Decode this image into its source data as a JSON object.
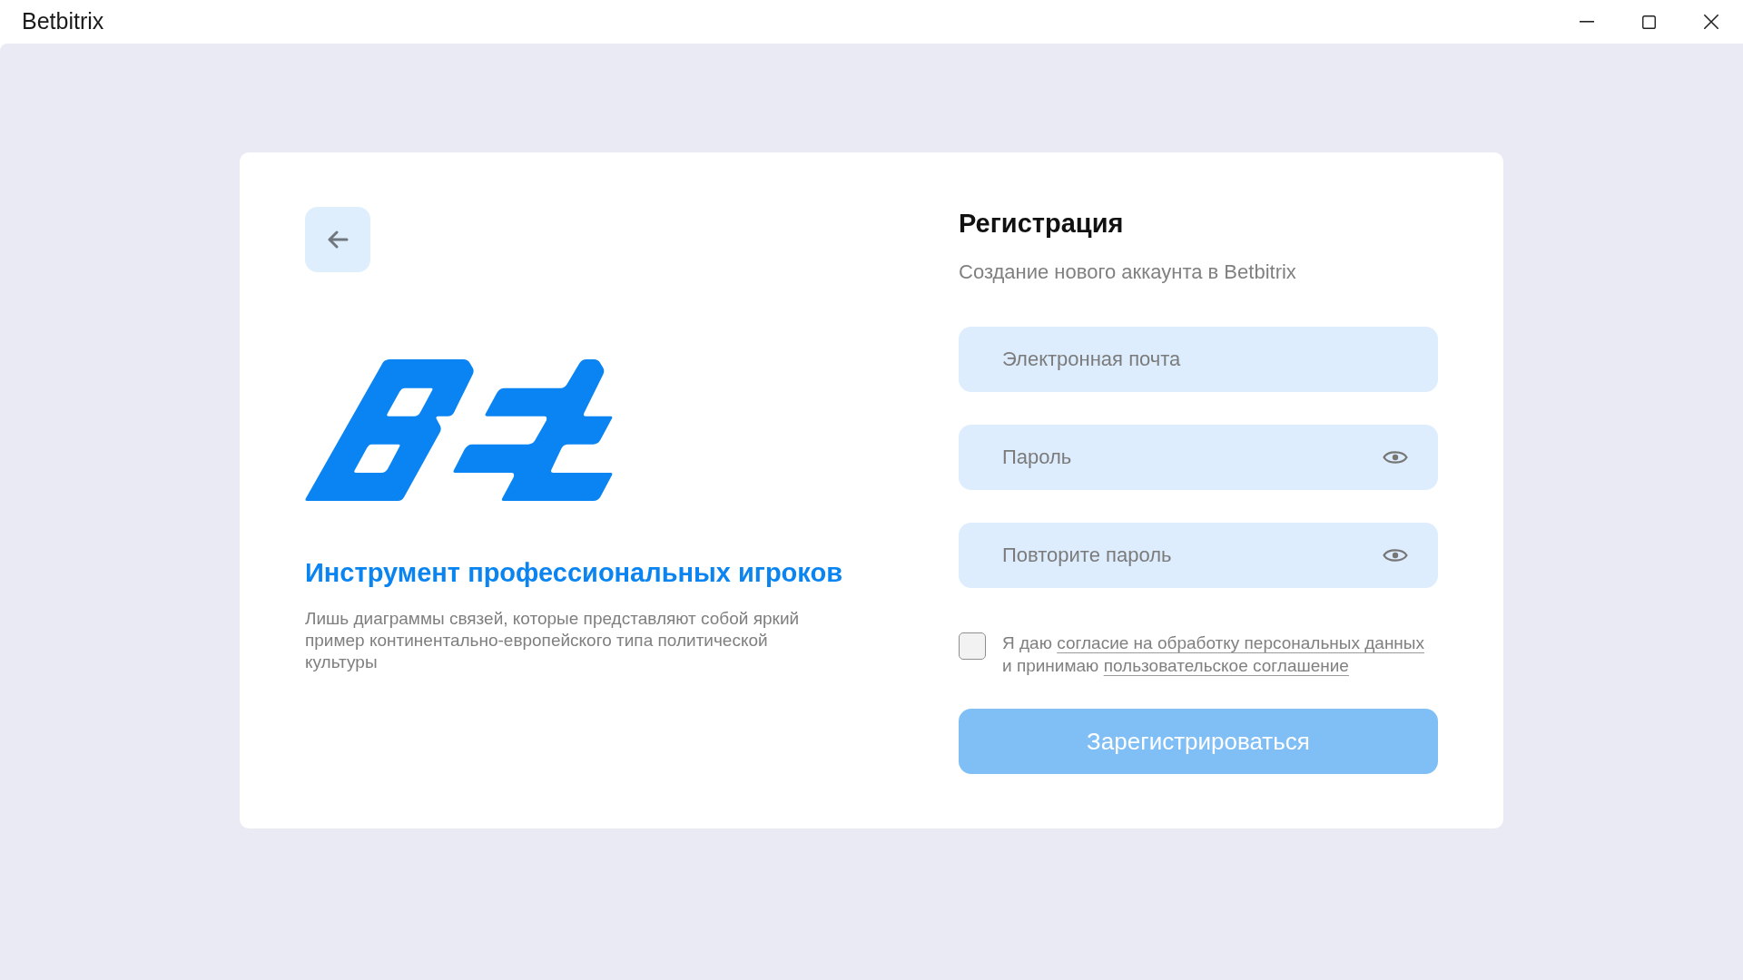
{
  "window": {
    "title": "Betbitrix"
  },
  "promo": {
    "heading": "Инструмент профессиональных игроков",
    "text": "Лишь диаграммы связей, которые представляют собой яркий пример континентально-европейского типа политической культуры"
  },
  "form": {
    "title": "Регистрация",
    "subtitle": "Создание нового аккаунта в Betbitrix",
    "fields": [
      {
        "kind": "email",
        "placeholder": "Электронная почта"
      },
      {
        "kind": "password",
        "placeholder": "Пароль"
      },
      {
        "kind": "password",
        "placeholder": "Повторите пароль"
      }
    ],
    "consent": {
      "checked": false,
      "lines": [
        {
          "text": "Я даю",
          "link": "согласие на обработку персональных данных"
        },
        {
          "text": "и принимаю",
          "link": "пользовательское соглашение"
        }
      ]
    },
    "submit": {
      "label": "Зарегистрироваться",
      "disabled": true
    }
  }
}
